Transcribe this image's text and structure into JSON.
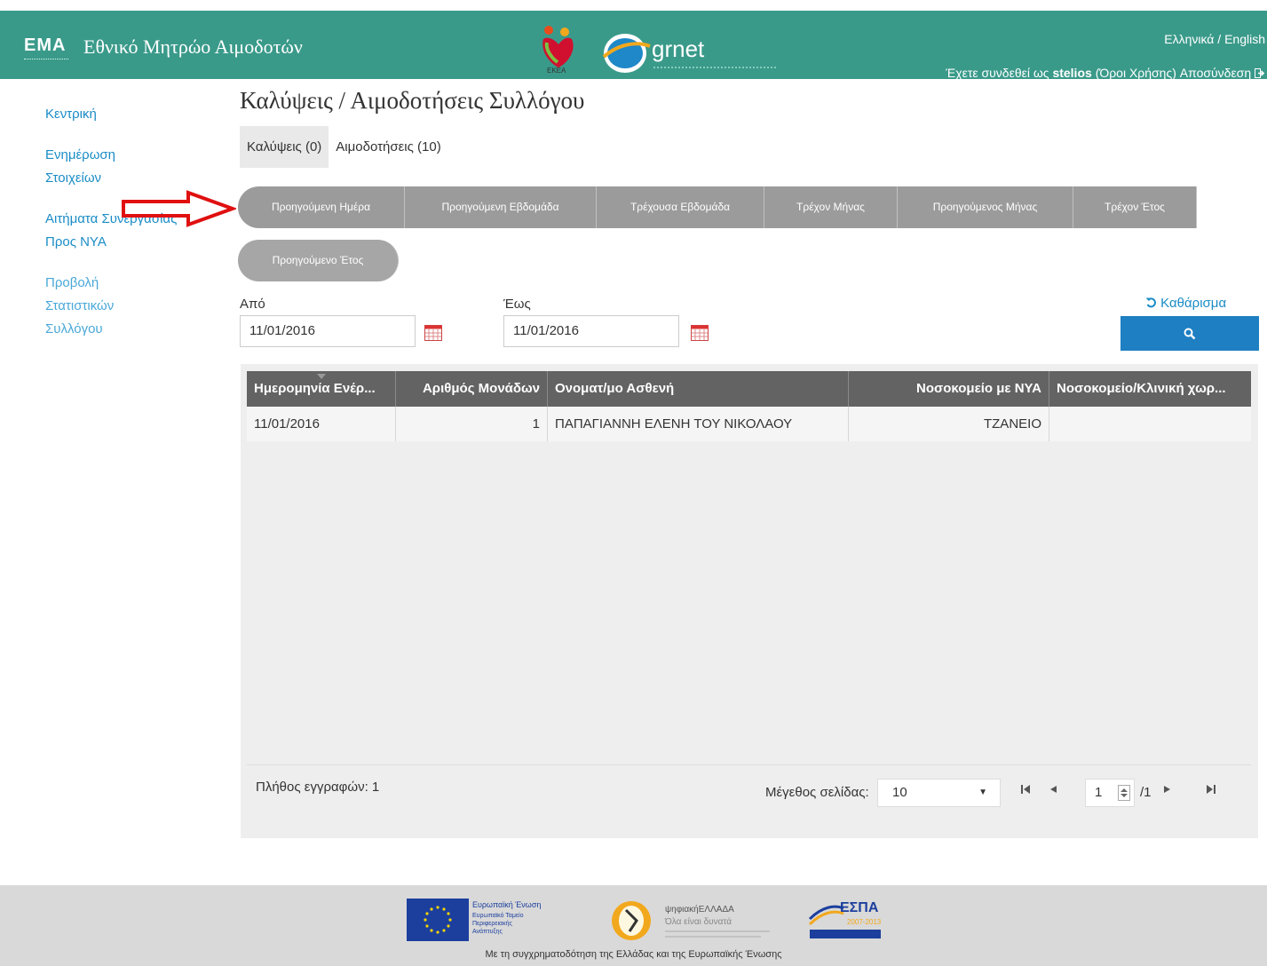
{
  "header": {
    "logo_text": "EMA",
    "title": "Εθνικό Μητρώο Αιμοδοτών",
    "ekea_logo_text": "ΕΚΕΑ",
    "grnet_logo_text": "grnet",
    "lang_el": "Ελληνικά",
    "lang_sep": " / ",
    "lang_en": "English",
    "logged_in_prefix": "Έχετε συνδεθεί ως ",
    "username": "stelios",
    "terms": "(Όροι Χρήσης)",
    "logout": "Αποσύνδεση",
    "logout_icon": "sign-out-icon"
  },
  "sidebar": {
    "items": [
      {
        "label": "Κεντρική"
      },
      {
        "label": "Ενημέρωση Στοιχείων"
      },
      {
        "label": "Αιτήματα Συνεργασίας Προς ΝΥΑ"
      },
      {
        "label": "Προβολή Στατιστικών Συλλόγου"
      }
    ]
  },
  "main": {
    "title": "Καλύψεις / Αιμοδοτήσεις Συλλόγου",
    "tabs": [
      {
        "label": "Καλύψεις (0)"
      },
      {
        "label": "Αιμοδοτήσεις (10)"
      }
    ],
    "filters": [
      {
        "label": "Προηγούμενη Ημέρα"
      },
      {
        "label": "Προηγούμενη Εβδομάδα"
      },
      {
        "label": "Τρέχουσα Εβδομάδα"
      },
      {
        "label": "Τρέχον Μήνας"
      },
      {
        "label": "Προηγούμενος Μήνας"
      },
      {
        "label": "Τρέχον Έτος"
      },
      {
        "label": "Προηγούμενο Έτος"
      }
    ],
    "from_label": "Από",
    "from_value": "11/01/2016",
    "to_label": "Έως",
    "to_value": "11/01/2016",
    "clear_label": "Καθάρισμα",
    "clear_icon": "undo-icon",
    "search_icon": "search-icon",
    "calendar_icon": "calendar-icon"
  },
  "grid": {
    "columns": [
      "Ημερομηνία Ενέρ...",
      "Αριθμός Μονάδων",
      "Ονοματ/μο Ασθενή",
      "Νοσοκομείο με ΝΥΑ",
      "Νοσοκομείο/Κλινική χωρ..."
    ],
    "rows": [
      [
        "11/01/2016",
        "1",
        "ΠΑΠΑΓΙΑΝΝΗ ΕΛΕΝΗ ΤΟΥ ΝΙΚΟΛΑΟΥ",
        "ΤΖΑΝΕΙΟ",
        ""
      ]
    ],
    "total_label": "Πλήθος εγγραφών: 1",
    "page_size_label": "Μέγεθος σελίδας:",
    "page_size_value": "10",
    "page_value": "1",
    "page_total": "/1"
  },
  "footer": {
    "cofund_text": "Με τη συγχρηματοδότηση της Ελλάδας και της Ευρωπαϊκής Ένωσης",
    "eu_logo_line1": "Ευρωπαϊκή Ένωση",
    "eu_logo_line2": "Ευρωπαϊκό Ταμείο",
    "eu_logo_line3": "Περιφερειακής",
    "eu_logo_line4": "Ανάπτυξης",
    "digital_logo_title": "ψηφιακήΕΛΛΑΔΑ",
    "digital_logo_sub": "Όλα είναι δυνατά",
    "espa_logo_title": "ΕΣΠΑ",
    "espa_logo_years": "2007-2013"
  },
  "colors": {
    "header_bg": "#3a9a8a",
    "link": "#1a8cc6",
    "filter_btn": "#9b9b9b",
    "grid_head": "#636363",
    "search_btn": "#1e7fc2"
  }
}
